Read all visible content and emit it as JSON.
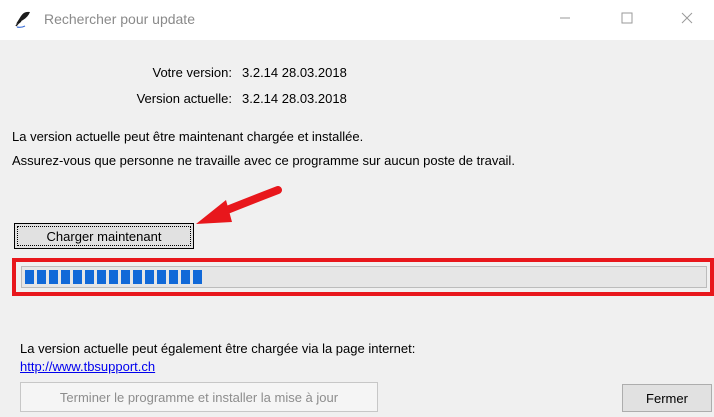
{
  "window": {
    "title": "Rechercher pour update",
    "controls": {
      "minimize": "—",
      "maximize": "☐",
      "close": "✕"
    }
  },
  "versions": {
    "yours_label": "Votre version:",
    "yours_value": "3.2.14  28.03.2018",
    "current_label": "Version actuelle:",
    "current_value": "3.2.14  28.03.2018"
  },
  "message": {
    "line1": "La version actuelle peut être maintenant chargée et installée.",
    "line2": "Assurez-vous que personne ne travaille avec ce programme sur aucun poste de travail."
  },
  "buttons": {
    "load": "Charger maintenant",
    "finish": "Terminer le programme et installer la mise à jour",
    "close": "Fermer"
  },
  "progress": {
    "fraction": 0.27,
    "segments": 15
  },
  "web": {
    "text": "La version actuelle peut également être chargée via la page internet:",
    "link": "http://www.tbsupport.ch"
  },
  "colors": {
    "annotation": "#e8171c",
    "progress": "#1169d8"
  }
}
